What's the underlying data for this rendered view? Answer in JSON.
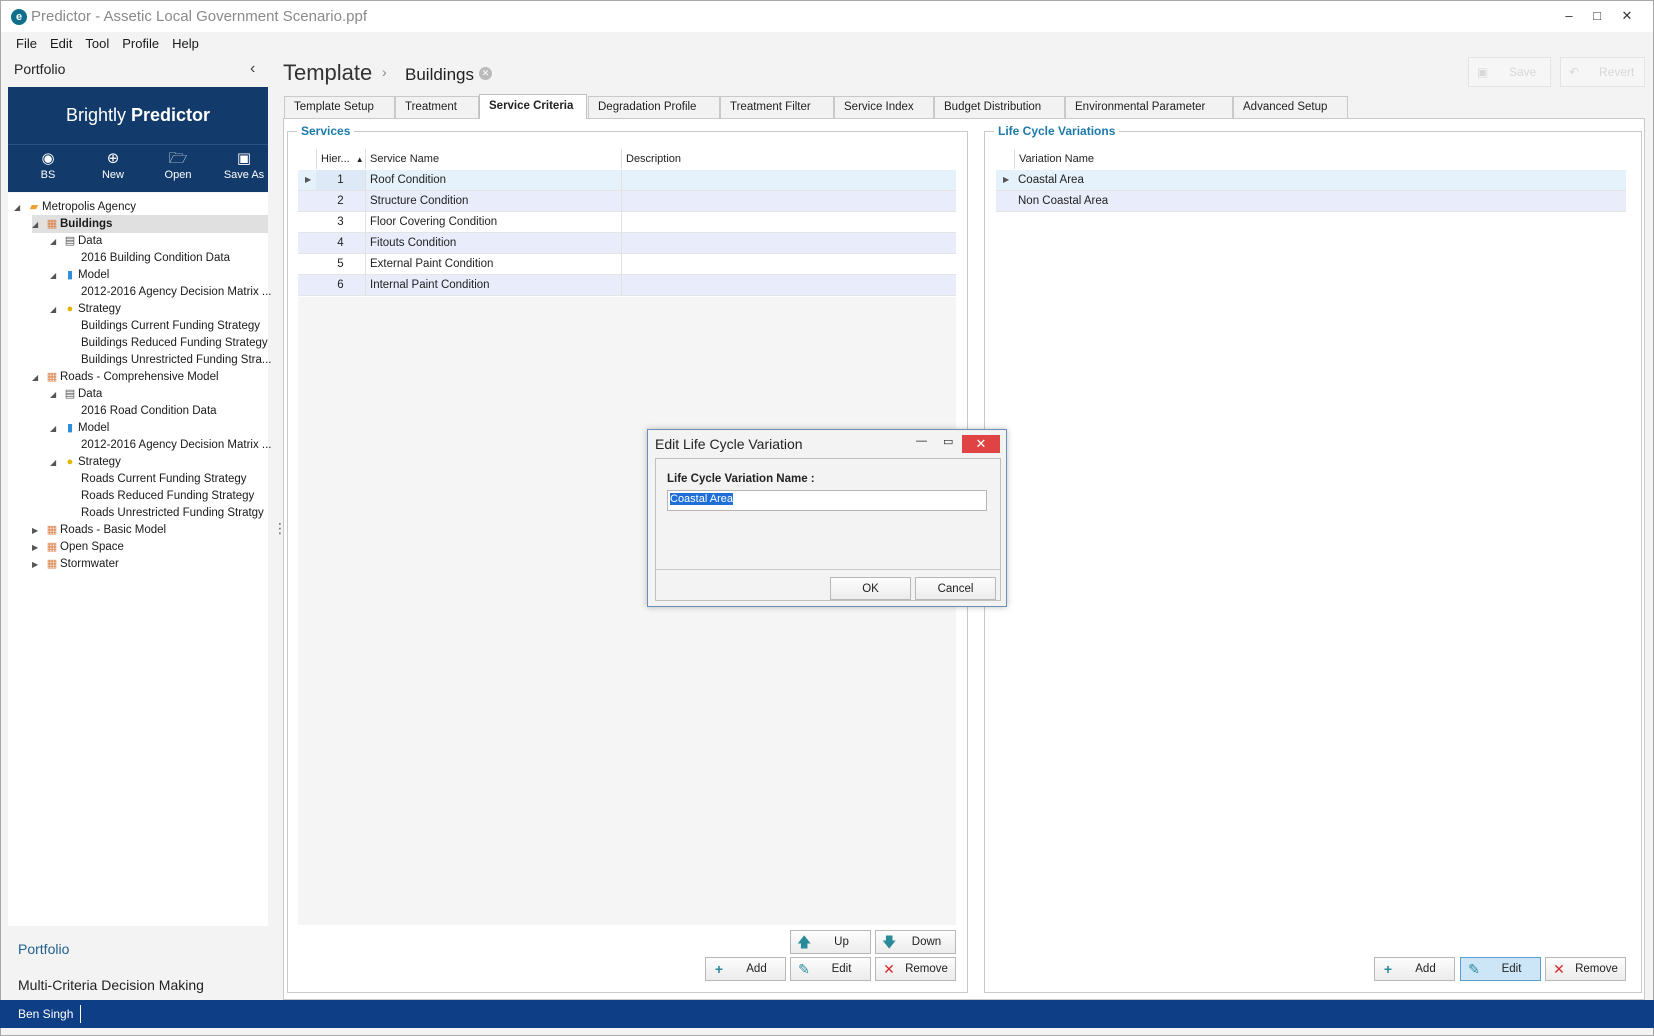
{
  "window": {
    "title": "Predictor - Assetic Local Government Scenario.ppf",
    "icon_letter": "e"
  },
  "menu": [
    "File",
    "Edit",
    "Tool",
    "Profile",
    "Help"
  ],
  "sidebar": {
    "header": "Portfolio",
    "brand_light": "Brightly",
    "brand_bold": "Predictor",
    "tools": [
      {
        "label": "BS",
        "icon": "user-icon"
      },
      {
        "label": "New",
        "icon": "plus-circle-icon"
      },
      {
        "label": "Open",
        "icon": "folder-open-icon"
      },
      {
        "label": "Save As",
        "icon": "save-icon"
      }
    ],
    "tree": [
      {
        "label": "Metropolis Agency",
        "icon": "agency-icon"
      },
      {
        "label": "Buildings",
        "icon": "portfolio-icon"
      },
      {
        "label": "Data",
        "icon": "database-icon"
      },
      {
        "label": "2016 Building Condition Data"
      },
      {
        "label": "Model",
        "icon": "chart-icon"
      },
      {
        "label": "2012-2016 Agency Decision Matrix ..."
      },
      {
        "label": "Strategy",
        "icon": "coins-icon"
      },
      {
        "label": "Buildings Current Funding Strategy"
      },
      {
        "label": "Buildings Reduced Funding Strategy"
      },
      {
        "label": "Buildings Unrestricted Funding Stra..."
      },
      {
        "label": "Roads - Comprehensive Model",
        "icon": "portfolio-icon"
      },
      {
        "label": "Data",
        "icon": "database-icon"
      },
      {
        "label": "2016 Road Condition Data"
      },
      {
        "label": "Model",
        "icon": "chart-icon"
      },
      {
        "label": "2012-2016 Agency Decision Matrix ..."
      },
      {
        "label": "Strategy",
        "icon": "coins-icon"
      },
      {
        "label": "Roads Current Funding Strategy"
      },
      {
        "label": "Roads Reduced Funding Strategy"
      },
      {
        "label": "Roads Unrestricted Funding Stratgy"
      },
      {
        "label": "Roads - Basic Model",
        "icon": "portfolio-icon"
      },
      {
        "label": "Open Space",
        "icon": "portfolio-icon"
      },
      {
        "label": "Stormwater",
        "icon": "portfolio-icon"
      }
    ],
    "nav": [
      "Portfolio",
      "Multi-Criteria Decision Making"
    ]
  },
  "breadcrumb": {
    "root": "Template",
    "current": "Buildings"
  },
  "toolbar": {
    "save": "Save",
    "revert": "Revert"
  },
  "tabs": [
    "Template Setup",
    "Treatment",
    "Service Criteria",
    "Degradation Profile",
    "Treatment Filter",
    "Service Index",
    "Budget Distribution",
    "Environmental Parameter",
    "Advanced Setup"
  ],
  "active_tab": "Service Criteria",
  "services": {
    "title": "Services",
    "columns": [
      "Hier...",
      "Service Name",
      "Description"
    ],
    "rows": [
      {
        "hier": "1",
        "name": "Roof Condition",
        "desc": ""
      },
      {
        "hier": "2",
        "name": "Structure Condition",
        "desc": ""
      },
      {
        "hier": "3",
        "name": "Floor Covering Condition",
        "desc": ""
      },
      {
        "hier": "4",
        "name": "Fitouts Condition",
        "desc": ""
      },
      {
        "hier": "5",
        "name": "External Paint Condition",
        "desc": ""
      },
      {
        "hier": "6",
        "name": "Internal Paint Condition",
        "desc": ""
      }
    ],
    "buttons": {
      "up": "Up",
      "down": "Down",
      "add": "Add",
      "edit": "Edit",
      "remove": "Remove"
    }
  },
  "lifecycle": {
    "title": "Life Cycle Variations",
    "columns": [
      "Variation Name"
    ],
    "rows": [
      "Coastal Area",
      "Non Coastal Area"
    ],
    "buttons": {
      "add": "Add",
      "edit": "Edit",
      "remove": "Remove"
    }
  },
  "dialog": {
    "title": "Edit Life Cycle Variation",
    "label": "Life Cycle Variation Name :",
    "value": "Coastal Area",
    "ok": "OK",
    "cancel": "Cancel"
  },
  "status": {
    "user": "Ben Singh"
  },
  "colors": {
    "brand": "#123a6a",
    "status_bar": "#0e3f86",
    "accent": "#1c7aa8",
    "close_red": "#e04343",
    "alt_row": "#e9ecfb"
  }
}
